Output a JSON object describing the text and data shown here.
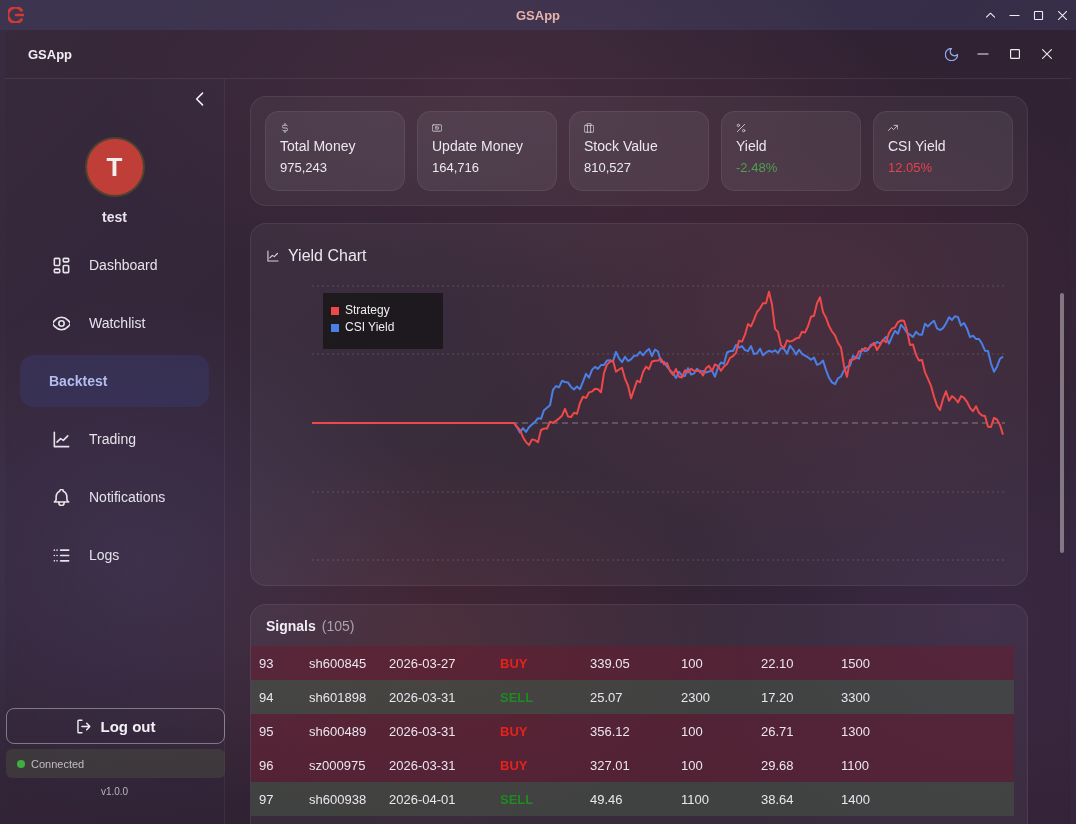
{
  "window": {
    "title": "GSApp"
  },
  "app_header": {
    "title": "GSApp"
  },
  "sidebar": {
    "user": {
      "initial": "T",
      "name": "test"
    },
    "items": [
      {
        "label": "Dashboard",
        "selected": false
      },
      {
        "label": "Watchlist",
        "selected": false
      },
      {
        "label": "Backtest",
        "selected": true
      },
      {
        "label": "Trading",
        "selected": false
      },
      {
        "label": "Notifications",
        "selected": false
      },
      {
        "label": "Logs",
        "selected": false
      }
    ],
    "logout": "Log out",
    "status": {
      "label": "Connected",
      "connected": true
    },
    "version": "v1.0.0"
  },
  "stats": [
    {
      "label": "Total Money",
      "value": "975,243"
    },
    {
      "label": "Update Money",
      "value": "164,716"
    },
    {
      "label": "Stock Value",
      "value": "810,527"
    },
    {
      "label": "Yield",
      "value": "-2.48%",
      "color": "#4e9f4e"
    },
    {
      "label": "CSI Yield",
      "value": "12.05%",
      "color": "#e5434b"
    }
  ],
  "yield_chart": {
    "title": "Yield Chart",
    "legend": [
      {
        "label": "Strategy",
        "color": "#ef4848"
      },
      {
        "label": "CSI Yield",
        "color": "#4a7fe6"
      }
    ]
  },
  "signals": {
    "title": "Signals",
    "count": "(105)",
    "rows": [
      {
        "kind": "buy",
        "cells": [
          "93",
          "sh600845",
          "2026-03-27",
          "BUY",
          "339.05",
          "100",
          "22.10",
          "1500"
        ]
      },
      {
        "kind": "sell",
        "cells": [
          "94",
          "sh601898",
          "2026-03-31",
          "SELL",
          "25.07",
          "2300",
          "17.20",
          "3300"
        ]
      },
      {
        "kind": "buy",
        "cells": [
          "95",
          "sh600489",
          "2026-03-31",
          "BUY",
          "356.12",
          "100",
          "26.71",
          "1300"
        ]
      },
      {
        "kind": "buy",
        "cells": [
          "96",
          "sz000975",
          "2026-03-31",
          "BUY",
          "327.01",
          "100",
          "29.68",
          "1100"
        ]
      },
      {
        "kind": "sell",
        "cells": [
          "97",
          "sh600938",
          "2026-04-01",
          "SELL",
          "49.46",
          "1100",
          "38.64",
          "1400"
        ]
      }
    ]
  }
}
